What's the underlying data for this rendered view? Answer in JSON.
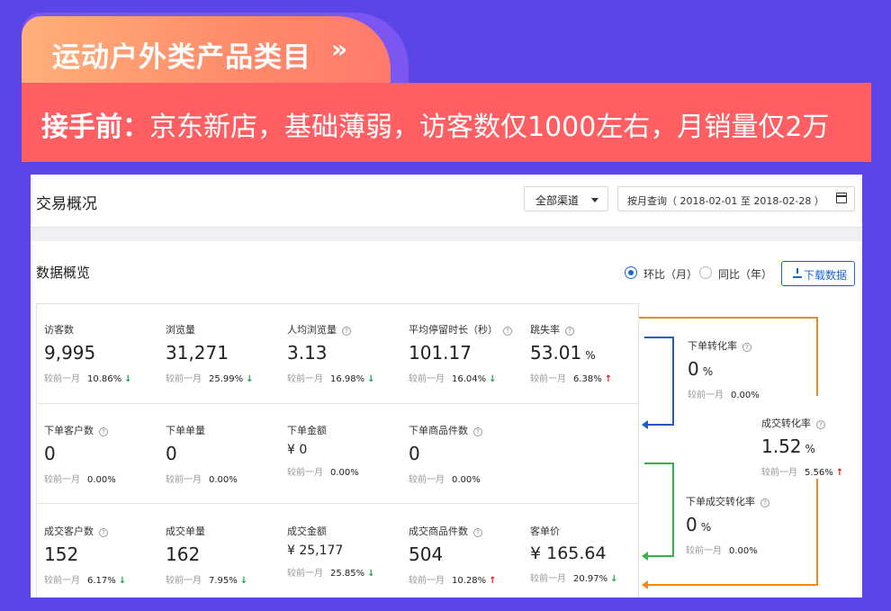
{
  "header": {
    "tab_title": "运动户外类产品类目",
    "tab_arrow": "»",
    "banner_bold": "接手前：",
    "banner_text": "京东新店，基础薄弱，访客数仅1000左右，月销量仅2万"
  },
  "panel": {
    "title": "交易概况",
    "channel_select": "全部渠道",
    "date_range": "按月查询（ 2018-02-01 至 2018-02-28 ）",
    "section_title": "数据概览",
    "radio_mom": "环比（月）",
    "radio_yoy": "同比（年）",
    "download": "下载数据"
  },
  "compare_label": "较前一月",
  "metrics_row1": [
    {
      "label": "访客数",
      "value": "9,995",
      "pct": "10.86%",
      "dir": "↓"
    },
    {
      "label": "浏览量",
      "value": "31,271",
      "pct": "25.99%",
      "dir": "↓"
    },
    {
      "label": "人均浏览量",
      "value": "3.13",
      "pct": "16.98%",
      "dir": "↓"
    },
    {
      "label": "平均停留时长（秒）",
      "value": "101.17",
      "pct": "16.04%",
      "dir": "↓"
    },
    {
      "label": "跳失率",
      "value": "53.01",
      "unit": "%",
      "pct": "6.38%",
      "dir": "↑"
    }
  ],
  "metrics_row2": [
    {
      "label": "下单客户数",
      "value": "0",
      "pct": "0.00%"
    },
    {
      "label": "下单单量",
      "value": "0",
      "pct": "0.00%"
    },
    {
      "label": "下单金额",
      "value": "¥ 0",
      "pct": "0.00%"
    },
    {
      "label": "下单商品件数",
      "value": "0",
      "pct": "0.00%"
    }
  ],
  "metrics_row3": [
    {
      "label": "成交客户数",
      "value": "152",
      "pct": "6.17%",
      "dir": "↓"
    },
    {
      "label": "成交单量",
      "value": "162",
      "pct": "7.95%",
      "dir": "↓"
    },
    {
      "label": "成交金额",
      "value": "¥ 25,177",
      "pct": "25.85%",
      "dir": "↓"
    },
    {
      "label": "成交商品件数",
      "value": "504",
      "pct": "10.28%",
      "dir": "↑"
    },
    {
      "label": "客单价",
      "value": "¥ 165.64",
      "pct": "20.97%",
      "dir": "↓"
    }
  ],
  "conversions": [
    {
      "label": "下单转化率",
      "value": "0",
      "unit": "%",
      "pct": "0.00%"
    },
    {
      "label": "成交转化率",
      "value": "1.52",
      "unit": "%",
      "pct": "5.56%",
      "dir": "↑"
    },
    {
      "label": "下单成交转化率",
      "value": "0",
      "unit": "%",
      "pct": "0.00%"
    }
  ],
  "colors": {
    "background": "#5b45e6",
    "banner": "#ff5f63",
    "up": "#e02020",
    "down": "#1aa34a",
    "accent": "#1a64d8"
  }
}
